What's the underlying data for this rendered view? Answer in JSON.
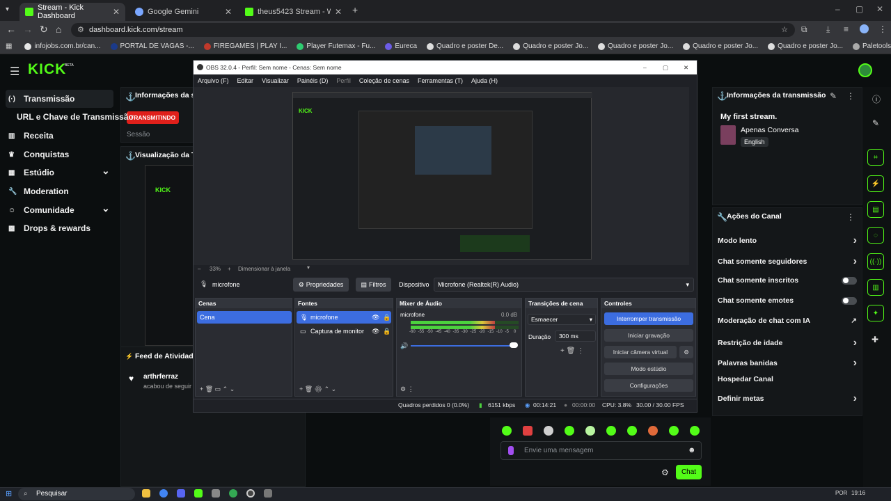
{
  "browser": {
    "tabs": [
      {
        "title": "Stream - Kick Dashboard",
        "active": true,
        "favicon_color": "#53fc18"
      },
      {
        "title": "Google Gemini",
        "active": false,
        "favicon_color": "#7aa7ff"
      },
      {
        "title": "theus5423 Stream - Watch Live",
        "active": false,
        "favicon_color": "#53fc18"
      }
    ],
    "url": "dashboard.kick.com/stream",
    "bookmarks": [
      {
        "label": "infojobs.com.br/can...",
        "color": "#e6e6e6"
      },
      {
        "label": "PORTAL DE VAGAS -...",
        "color": "#1b3a8a"
      },
      {
        "label": "FIREGAMES | PLAY I...",
        "color": "#c0392b"
      },
      {
        "label": "Player Futemax - Fu...",
        "color": "#2ecc71"
      },
      {
        "label": "Eureca",
        "color": "#6c5ce7"
      },
      {
        "label": "Quadro e poster De...",
        "color": "#dddddd"
      },
      {
        "label": "Quadro e poster Jo...",
        "color": "#dddddd"
      },
      {
        "label": "Quadro e poster Jo...",
        "color": "#dddddd"
      },
      {
        "label": "Quadro e poster Jo...",
        "color": "#dddddd"
      },
      {
        "label": "Quadro e poster Jo...",
        "color": "#dddddd"
      },
      {
        "label": "Paletools v26.0.24",
        "color": "#aaaaaa"
      }
    ]
  },
  "kick": {
    "logo": "KICK",
    "logo_badge": "BETA",
    "sidebar": [
      {
        "icon": "broadcast-icon",
        "label": "Transmissão",
        "active": true
      },
      {
        "icon": "",
        "label": "URL e Chave de Transmissão",
        "active": false
      },
      {
        "icon": "revenue-icon",
        "label": "Receita",
        "active": false
      },
      {
        "icon": "trophy-icon",
        "label": "Conquistas",
        "active": false
      },
      {
        "icon": "studio-icon",
        "label": "Estúdio",
        "active": false
      },
      {
        "icon": "wrench-icon",
        "label": "Moderation",
        "active": false
      },
      {
        "icon": "community-icon",
        "label": "Comunidade",
        "active": false
      },
      {
        "icon": "drops-icon",
        "label": "Drops & rewards",
        "active": false
      }
    ],
    "session_panel": {
      "title": "Informações da se",
      "badge": "TRANSMITINDO",
      "sub": "Sessão"
    },
    "preview_panel": {
      "title": "Visualização da Tr"
    },
    "activity_feed": {
      "title": "Feed de Atividades",
      "user": "arthrferraz",
      "action": "acabou de seguir c"
    },
    "stream_info": {
      "title": "Informações da transmissão",
      "stream_title": "My first stream.",
      "category": "Apenas Conversa",
      "language": "English"
    },
    "channel_actions": {
      "title": "Ações do Canal",
      "items": [
        {
          "label": "Modo lento",
          "control": "chevron"
        },
        {
          "label": "Chat somente seguidores",
          "control": "chevron"
        },
        {
          "label": "Chat somente inscritos",
          "control": "toggle"
        },
        {
          "label": "Chat somente emotes",
          "control": "toggle"
        },
        {
          "label": "Moderação de chat com IA",
          "control": "external"
        },
        {
          "label": "Restrição de idade",
          "control": "chevron"
        },
        {
          "label": "Palavras banidas",
          "control": "chevron"
        },
        {
          "label": "Hospedar Canal",
          "control": "none"
        },
        {
          "label": "Definir metas",
          "control": "chevron"
        }
      ]
    },
    "chat": {
      "placeholder": "Envie uma mensagem",
      "send": "Chat"
    }
  },
  "obs": {
    "title": "OBS 32.0.4 - Perfil: Sem nome - Cenas: Sem nome",
    "menu": [
      "Arquivo (F)",
      "Editar",
      "Visualizar",
      "Painéis (D)",
      "Perfil",
      "Coleção de cenas",
      "Ferramentas (T)",
      "Ajuda (H)"
    ],
    "zoom": "33%",
    "resize": "Dimensionar à janela",
    "source_bar": {
      "source": "microfone",
      "properties": "Propriedades",
      "filters": "Filtros",
      "device_label": "Dispositivo",
      "device": "Microfone (Realtek(R) Audio)"
    },
    "scenes": {
      "title": "Cenas",
      "items": [
        "Cena"
      ]
    },
    "sources": {
      "title": "Fontes",
      "items": [
        "microfone",
        "Captura de monitor"
      ]
    },
    "mixer": {
      "title": "Mixer de Áudio",
      "channel": "microfone",
      "db": "0.0 dB",
      "ticks": [
        "-60",
        "-55",
        "-50",
        "-45",
        "-40",
        "-35",
        "-30",
        "-25",
        "-20",
        "-15",
        "-10",
        "-5",
        "0"
      ],
      "level": 0.78
    },
    "transitions": {
      "title": "Transições de cena",
      "type": "Esmaecer",
      "duration_label": "Duração",
      "duration": "300 ms"
    },
    "controls": {
      "title": "Controles",
      "buttons": [
        "Interromper transmissão",
        "Iniciar gravação",
        "Iniciar câmera virtual",
        "Modo estúdio",
        "Configurações"
      ]
    },
    "status": {
      "dropped": "Quadros perdidos 0 (0.0%)",
      "bitrate": "6151 kbps",
      "live_time": "00:14:21",
      "rec_time": "00:00:00",
      "cpu": "CPU: 3.8%",
      "fps": "30.00 / 30.00 FPS"
    }
  },
  "taskbar": {
    "search": "Pesquisar",
    "lang": "POR",
    "time": "19:16"
  }
}
